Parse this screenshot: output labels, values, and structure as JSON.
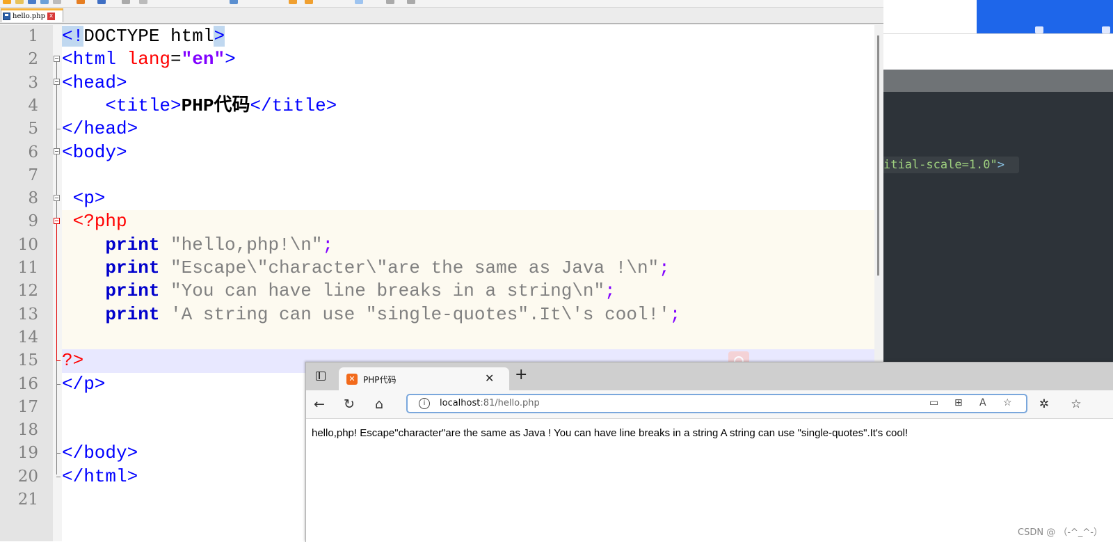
{
  "editor": {
    "file_tab": "hello.php",
    "close": "x",
    "line_numbers": [
      "1",
      "2",
      "3",
      "4",
      "5",
      "6",
      "7",
      "8",
      "9",
      "10",
      "11",
      "12",
      "13",
      "14",
      "15",
      "16",
      "17",
      "18",
      "19",
      "20",
      "21"
    ],
    "code": {
      "l1": {
        "a": "<!",
        "b": "DOCTYPE html",
        "c": ">"
      },
      "l2": {
        "a": "<html ",
        "b": "lang",
        "c": "=",
        "d": "\"en\"",
        "e": ">"
      },
      "l3": "<head>",
      "l4": {
        "a": "    <title>",
        "b": "PHP代码",
        "c": "</title>"
      },
      "l5": "</head>",
      "l6": "<body>",
      "l8": " <p>",
      "l9": " <?php",
      "l10": {
        "kw": "    print ",
        "s": "\"hello,php!\\n\"",
        "sc": ";"
      },
      "l11": {
        "kw": "    print ",
        "s": "\"Escape\\\"character\\\"are the same as Java !\\n\"",
        "sc": ";"
      },
      "l12": {
        "kw": "    print ",
        "s": "\"You can have line breaks in a string\\n\"",
        "sc": ";"
      },
      "l13": {
        "kw": "    print ",
        "s": "'A string can use \"single-quotes\".It\\'s cool!'",
        "sc": ";"
      },
      "l15": "?>",
      "l16": "</p>",
      "l19": "</body>",
      "l20": "</html>"
    }
  },
  "background": {
    "code_snippet": "itial-scale=1.0\"",
    "code_snippet_end": ">"
  },
  "browser": {
    "tab_title": "PHP代码",
    "tab_close": "✕",
    "new_tab": "+",
    "back": "←",
    "reload": "↻",
    "home": "⌂",
    "info": "i",
    "url_host": "localhost",
    "url_path": ":81/hello.php",
    "page_text": "hello,php! Escape\"character\"are the same as Java ! You can have line breaks in a string A string can use \"single-quotes\".It's cool!"
  },
  "watermark": "CSDN @ （-^_^-）"
}
